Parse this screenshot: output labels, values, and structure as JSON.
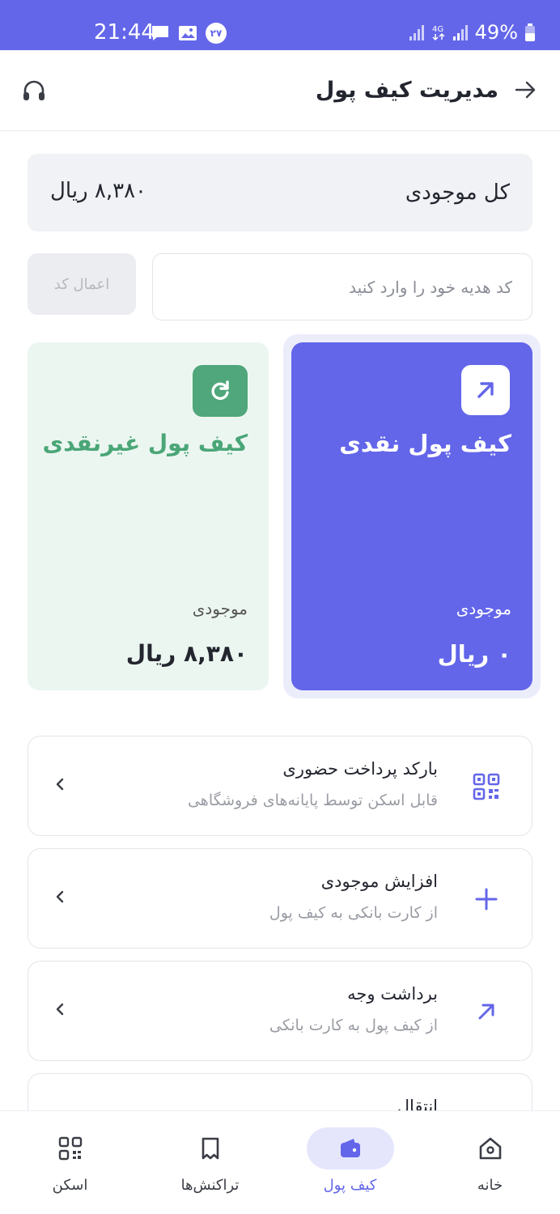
{
  "status_bar": {
    "time": "21:44",
    "notification_count": "۲۷",
    "network": "4G",
    "battery": "49%"
  },
  "header": {
    "title": "مدیریت کیف پول"
  },
  "total": {
    "label": "کل موجودی",
    "value": "۸,۳۸۰ ریال"
  },
  "gift": {
    "placeholder": "کد هدیه خود را وارد کنید",
    "apply_label": "اعمال کد"
  },
  "wallets": {
    "cash": {
      "title": "کیف پول نقدی",
      "balance_label": "موجودی",
      "balance_value": "۰ ریال"
    },
    "noncash": {
      "title": "کیف پول غیرنقدی",
      "balance_label": "موجودی",
      "balance_value": "۸,۳۸۰ ریال"
    }
  },
  "actions": [
    {
      "title": "بارکد پرداخت حضوری",
      "subtitle": "قابل اسکن توسط پایانه‌های فروشگاهی",
      "icon": "qr-code-icon"
    },
    {
      "title": "افزایش موجودی",
      "subtitle": "از کارت بانکی به کیف پول",
      "icon": "plus-icon"
    },
    {
      "title": "برداشت وجه",
      "subtitle": "از کیف پول به کارت بانکی",
      "icon": "arrow-up-right-icon"
    },
    {
      "title": "انتقال",
      "subtitle": "",
      "icon": ""
    }
  ],
  "bottom_nav": [
    {
      "label": "خانه",
      "icon": "home-icon"
    },
    {
      "label": "کیف پول",
      "icon": "wallet-icon",
      "active": true
    },
    {
      "label": "تراکنش‌ها",
      "icon": "receipt-icon"
    },
    {
      "label": "اسکن",
      "icon": "qr-scan-icon"
    }
  ],
  "colors": {
    "primary": "#6366e9",
    "green": "#4fa77b",
    "green_bg": "#ecf6f1",
    "muted": "#9a9ca4"
  }
}
